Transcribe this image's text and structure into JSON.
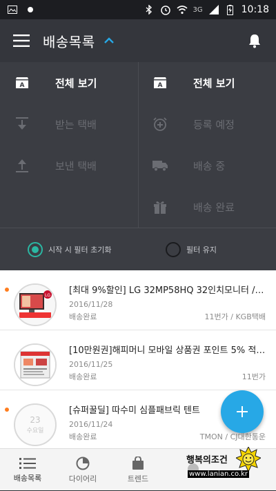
{
  "status_bar": {
    "time": "10:18",
    "network": "3G"
  },
  "app_bar": {
    "title": "배송목록"
  },
  "filters": {
    "left": [
      {
        "label": "전체 보기",
        "icon": "all-icon",
        "active": true
      },
      {
        "label": "받는 택배",
        "icon": "download-icon",
        "active": false
      },
      {
        "label": "보낸 택배",
        "icon": "upload-icon",
        "active": false
      }
    ],
    "right": [
      {
        "label": "전체 보기",
        "icon": "all-icon",
        "active": true
      },
      {
        "label": "등록 예정",
        "icon": "alarm-add-icon",
        "active": false
      },
      {
        "label": "배송 중",
        "icon": "truck-icon",
        "active": false
      },
      {
        "label": "배송 완료",
        "icon": "gift-icon",
        "active": false
      }
    ],
    "radio": [
      {
        "label": "시작 시 필터 초기화",
        "checked": true
      },
      {
        "label": "필터 유지",
        "checked": false
      }
    ]
  },
  "deliveries": [
    {
      "name": "[최대 9%할인] LG 32MP58HQ 32인치모니터 / IP...",
      "date": "2016/11/28",
      "status": "배송완료",
      "carrier": "11번가 / KGB택배",
      "unread": true
    },
    {
      "name": "[10만원권]해피머니 모바일 상품권 포인트 5% 적립!",
      "date": "2016/11/25",
      "status": "배송완료",
      "carrier": "11번가",
      "unread": false
    },
    {
      "name": "[슈퍼꿀딜] 따수미 심플패브릭 텐트",
      "date": "2016/11/24",
      "status": "배송완료",
      "carrier": "TMON / CJ대한통운",
      "unread": true,
      "thumb_day": "23",
      "thumb_weekday": "수요일"
    }
  ],
  "bottom_nav": [
    {
      "label": "배송목록",
      "icon": "list-icon"
    },
    {
      "label": "다이어리",
      "icon": "pie-icon"
    },
    {
      "label": "트렌드",
      "icon": "bag-icon"
    },
    {
      "label": "",
      "icon": "more-icon"
    }
  ],
  "watermark": {
    "url": "www.lanian.co.kr",
    "handwriting": "행복의조건"
  },
  "colors": {
    "accent": "#27a8e6",
    "teal": "#2bb7a3",
    "unread": "#ff7d1e"
  }
}
